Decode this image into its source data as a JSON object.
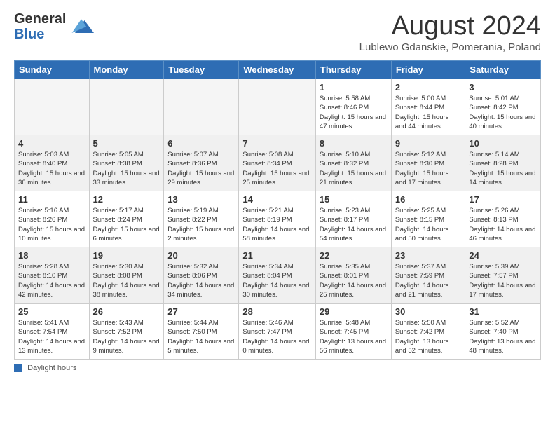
{
  "header": {
    "logo_line1": "General",
    "logo_line2": "Blue",
    "month_title": "August 2024",
    "subtitle": "Lublewo Gdanskie, Pomerania, Poland"
  },
  "days_of_week": [
    "Sunday",
    "Monday",
    "Tuesday",
    "Wednesday",
    "Thursday",
    "Friday",
    "Saturday"
  ],
  "footer_label": "Daylight hours",
  "weeks": [
    [
      {
        "day": "",
        "empty": true
      },
      {
        "day": "",
        "empty": true
      },
      {
        "day": "",
        "empty": true
      },
      {
        "day": "",
        "empty": true
      },
      {
        "day": "1",
        "sunrise": "5:58 AM",
        "sunset": "8:46 PM",
        "daylight": "15 hours and 47 minutes."
      },
      {
        "day": "2",
        "sunrise": "5:00 AM",
        "sunset": "8:44 PM",
        "daylight": "15 hours and 44 minutes."
      },
      {
        "day": "3",
        "sunrise": "5:01 AM",
        "sunset": "8:42 PM",
        "daylight": "15 hours and 40 minutes."
      }
    ],
    [
      {
        "day": "4",
        "sunrise": "5:03 AM",
        "sunset": "8:40 PM",
        "daylight": "15 hours and 36 minutes."
      },
      {
        "day": "5",
        "sunrise": "5:05 AM",
        "sunset": "8:38 PM",
        "daylight": "15 hours and 33 minutes."
      },
      {
        "day": "6",
        "sunrise": "5:07 AM",
        "sunset": "8:36 PM",
        "daylight": "15 hours and 29 minutes."
      },
      {
        "day": "7",
        "sunrise": "5:08 AM",
        "sunset": "8:34 PM",
        "daylight": "15 hours and 25 minutes."
      },
      {
        "day": "8",
        "sunrise": "5:10 AM",
        "sunset": "8:32 PM",
        "daylight": "15 hours and 21 minutes."
      },
      {
        "day": "9",
        "sunrise": "5:12 AM",
        "sunset": "8:30 PM",
        "daylight": "15 hours and 17 minutes."
      },
      {
        "day": "10",
        "sunrise": "5:14 AM",
        "sunset": "8:28 PM",
        "daylight": "15 hours and 14 minutes."
      }
    ],
    [
      {
        "day": "11",
        "sunrise": "5:16 AM",
        "sunset": "8:26 PM",
        "daylight": "15 hours and 10 minutes."
      },
      {
        "day": "12",
        "sunrise": "5:17 AM",
        "sunset": "8:24 PM",
        "daylight": "15 hours and 6 minutes."
      },
      {
        "day": "13",
        "sunrise": "5:19 AM",
        "sunset": "8:22 PM",
        "daylight": "15 hours and 2 minutes."
      },
      {
        "day": "14",
        "sunrise": "5:21 AM",
        "sunset": "8:19 PM",
        "daylight": "14 hours and 58 minutes."
      },
      {
        "day": "15",
        "sunrise": "5:23 AM",
        "sunset": "8:17 PM",
        "daylight": "14 hours and 54 minutes."
      },
      {
        "day": "16",
        "sunrise": "5:25 AM",
        "sunset": "8:15 PM",
        "daylight": "14 hours and 50 minutes."
      },
      {
        "day": "17",
        "sunrise": "5:26 AM",
        "sunset": "8:13 PM",
        "daylight": "14 hours and 46 minutes."
      }
    ],
    [
      {
        "day": "18",
        "sunrise": "5:28 AM",
        "sunset": "8:10 PM",
        "daylight": "14 hours and 42 minutes."
      },
      {
        "day": "19",
        "sunrise": "5:30 AM",
        "sunset": "8:08 PM",
        "daylight": "14 hours and 38 minutes."
      },
      {
        "day": "20",
        "sunrise": "5:32 AM",
        "sunset": "8:06 PM",
        "daylight": "14 hours and 34 minutes."
      },
      {
        "day": "21",
        "sunrise": "5:34 AM",
        "sunset": "8:04 PM",
        "daylight": "14 hours and 30 minutes."
      },
      {
        "day": "22",
        "sunrise": "5:35 AM",
        "sunset": "8:01 PM",
        "daylight": "14 hours and 25 minutes."
      },
      {
        "day": "23",
        "sunrise": "5:37 AM",
        "sunset": "7:59 PM",
        "daylight": "14 hours and 21 minutes."
      },
      {
        "day": "24",
        "sunrise": "5:39 AM",
        "sunset": "7:57 PM",
        "daylight": "14 hours and 17 minutes."
      }
    ],
    [
      {
        "day": "25",
        "sunrise": "5:41 AM",
        "sunset": "7:54 PM",
        "daylight": "14 hours and 13 minutes."
      },
      {
        "day": "26",
        "sunrise": "5:43 AM",
        "sunset": "7:52 PM",
        "daylight": "14 hours and 9 minutes."
      },
      {
        "day": "27",
        "sunrise": "5:44 AM",
        "sunset": "7:50 PM",
        "daylight": "14 hours and 5 minutes."
      },
      {
        "day": "28",
        "sunrise": "5:46 AM",
        "sunset": "7:47 PM",
        "daylight": "14 hours and 0 minutes."
      },
      {
        "day": "29",
        "sunrise": "5:48 AM",
        "sunset": "7:45 PM",
        "daylight": "13 hours and 56 minutes."
      },
      {
        "day": "30",
        "sunrise": "5:50 AM",
        "sunset": "7:42 PM",
        "daylight": "13 hours and 52 minutes."
      },
      {
        "day": "31",
        "sunrise": "5:52 AM",
        "sunset": "7:40 PM",
        "daylight": "13 hours and 48 minutes."
      }
    ]
  ]
}
